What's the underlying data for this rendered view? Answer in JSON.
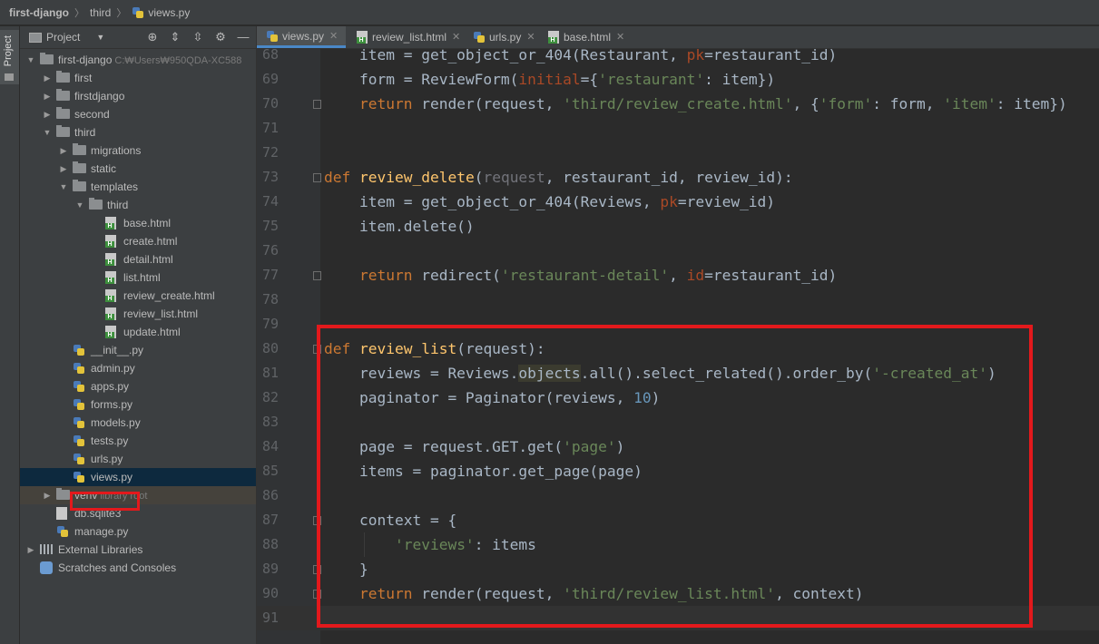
{
  "breadcrumb": {
    "project": "first-django",
    "folder": "third",
    "file": "views.py"
  },
  "toolwindow": {
    "label": "Project"
  },
  "project_panel": {
    "title": "Project",
    "tree": [
      {
        "name": "first-django",
        "indent": 0,
        "type": "folder",
        "expanded": true,
        "extra": "C:₩Users₩950QDA-XC588"
      },
      {
        "name": "first",
        "indent": 1,
        "type": "folder",
        "expanded": false,
        "extra": ""
      },
      {
        "name": "firstdjango",
        "indent": 1,
        "type": "folder",
        "expanded": false,
        "extra": ""
      },
      {
        "name": "second",
        "indent": 1,
        "type": "folder",
        "expanded": false,
        "extra": ""
      },
      {
        "name": "third",
        "indent": 1,
        "type": "folder",
        "expanded": true,
        "extra": ""
      },
      {
        "name": "migrations",
        "indent": 2,
        "type": "folder",
        "expanded": false,
        "extra": ""
      },
      {
        "name": "static",
        "indent": 2,
        "type": "folder",
        "expanded": false,
        "extra": ""
      },
      {
        "name": "templates",
        "indent": 2,
        "type": "folder",
        "expanded": true,
        "extra": ""
      },
      {
        "name": "third",
        "indent": 3,
        "type": "folder",
        "expanded": true,
        "extra": ""
      },
      {
        "name": "base.html",
        "indent": 4,
        "type": "html",
        "extra": ""
      },
      {
        "name": "create.html",
        "indent": 4,
        "type": "html",
        "extra": ""
      },
      {
        "name": "detail.html",
        "indent": 4,
        "type": "html",
        "extra": ""
      },
      {
        "name": "list.html",
        "indent": 4,
        "type": "html",
        "extra": ""
      },
      {
        "name": "review_create.html",
        "indent": 4,
        "type": "html",
        "extra": ""
      },
      {
        "name": "review_list.html",
        "indent": 4,
        "type": "html",
        "extra": ""
      },
      {
        "name": "update.html",
        "indent": 4,
        "type": "html",
        "extra": ""
      },
      {
        "name": "__init__.py",
        "indent": 2,
        "type": "py",
        "extra": ""
      },
      {
        "name": "admin.py",
        "indent": 2,
        "type": "py",
        "extra": ""
      },
      {
        "name": "apps.py",
        "indent": 2,
        "type": "py",
        "extra": ""
      },
      {
        "name": "forms.py",
        "indent": 2,
        "type": "py",
        "extra": ""
      },
      {
        "name": "models.py",
        "indent": 2,
        "type": "py",
        "extra": ""
      },
      {
        "name": "tests.py",
        "indent": 2,
        "type": "py",
        "extra": ""
      },
      {
        "name": "urls.py",
        "indent": 2,
        "type": "py",
        "extra": ""
      },
      {
        "name": "views.py",
        "indent": 2,
        "type": "py",
        "extra": "",
        "selected": true
      },
      {
        "name": "venv",
        "indent": 1,
        "type": "folder",
        "expanded": false,
        "extra": "library root",
        "venv": true
      },
      {
        "name": "db.sqlite3",
        "indent": 1,
        "type": "db",
        "extra": ""
      },
      {
        "name": "manage.py",
        "indent": 1,
        "type": "py",
        "extra": ""
      },
      {
        "name": "External Libraries",
        "indent": 0,
        "type": "lib",
        "expanded": false,
        "extra": ""
      },
      {
        "name": "Scratches and Consoles",
        "indent": 0,
        "type": "scratch",
        "extra": ""
      }
    ]
  },
  "tabs": [
    {
      "label": "views.py",
      "icon": "py",
      "active": true
    },
    {
      "label": "review_list.html",
      "icon": "html",
      "active": false
    },
    {
      "label": "urls.py",
      "icon": "py",
      "active": false
    },
    {
      "label": "base.html",
      "icon": "html",
      "active": false
    }
  ],
  "editor": {
    "current_line": 91,
    "lines": [
      {
        "n": 68,
        "segs": [
          [
            "    item = get_object_or_404(Restaurant, ",
            ""
          ],
          [
            "pk",
            "param"
          ],
          [
            "=restaurant_id)",
            ""
          ]
        ]
      },
      {
        "n": 69,
        "segs": [
          [
            "    form = ReviewForm(",
            ""
          ],
          [
            "initial",
            "param"
          ],
          [
            "={",
            ""
          ],
          [
            "'restaurant'",
            "str"
          ],
          [
            ": item})",
            ""
          ]
        ]
      },
      {
        "n": 70,
        "segs": [
          [
            "    ",
            ""
          ],
          [
            "return",
            "kw"
          ],
          [
            " render(request, ",
            ""
          ],
          [
            "'third/review_create.html'",
            "str"
          ],
          [
            ", {",
            ""
          ],
          [
            "'form'",
            "str"
          ],
          [
            ": form, ",
            ""
          ],
          [
            "'item'",
            "str"
          ],
          [
            ": item})",
            ""
          ]
        ]
      },
      {
        "n": 71,
        "segs": []
      },
      {
        "n": 72,
        "segs": []
      },
      {
        "n": 73,
        "segs": [
          [
            "def",
            "kw"
          ],
          [
            " ",
            ""
          ],
          [
            "review_delete",
            "fn"
          ],
          [
            "(",
            ""
          ],
          [
            "request",
            "gray"
          ],
          [
            ", restaurant_id, review_id):",
            ""
          ]
        ]
      },
      {
        "n": 74,
        "segs": [
          [
            "    item = get_object_or_404(Reviews, ",
            ""
          ],
          [
            "pk",
            "param"
          ],
          [
            "=review_id)",
            ""
          ]
        ]
      },
      {
        "n": 75,
        "segs": [
          [
            "    item.delete()",
            ""
          ]
        ]
      },
      {
        "n": 76,
        "segs": []
      },
      {
        "n": 77,
        "segs": [
          [
            "    ",
            ""
          ],
          [
            "return",
            "kw"
          ],
          [
            " redirect(",
            ""
          ],
          [
            "'restaurant-detail'",
            "str"
          ],
          [
            ", ",
            ""
          ],
          [
            "id",
            "param"
          ],
          [
            "=restaurant_id)",
            ""
          ]
        ]
      },
      {
        "n": 78,
        "segs": []
      },
      {
        "n": 79,
        "segs": []
      },
      {
        "n": 80,
        "segs": [
          [
            "def",
            "kw"
          ],
          [
            " ",
            ""
          ],
          [
            "review_list",
            "fn"
          ],
          [
            "(request):",
            ""
          ]
        ]
      },
      {
        "n": 81,
        "segs": [
          [
            "    reviews = Reviews.",
            ""
          ],
          [
            "objects",
            "obj"
          ],
          [
            ".all().select_related().order_by(",
            ""
          ],
          [
            "'-created_at'",
            "str"
          ],
          [
            ")",
            ""
          ]
        ]
      },
      {
        "n": 82,
        "segs": [
          [
            "    paginator = Paginator(reviews, ",
            ""
          ],
          [
            "10",
            "num"
          ],
          [
            ")",
            ""
          ]
        ]
      },
      {
        "n": 83,
        "segs": []
      },
      {
        "n": 84,
        "segs": [
          [
            "    page = request.GET.get(",
            ""
          ],
          [
            "'page'",
            "str"
          ],
          [
            ")",
            ""
          ]
        ]
      },
      {
        "n": 85,
        "segs": [
          [
            "    items = paginator.get_page(page)",
            ""
          ]
        ]
      },
      {
        "n": 86,
        "segs": []
      },
      {
        "n": 87,
        "segs": [
          [
            "    context = {",
            ""
          ]
        ]
      },
      {
        "n": 88,
        "segs": [
          [
            "        ",
            ""
          ],
          [
            "'reviews'",
            "str"
          ],
          [
            ": items",
            ""
          ]
        ]
      },
      {
        "n": 89,
        "segs": [
          [
            "    }",
            ""
          ]
        ]
      },
      {
        "n": 90,
        "segs": [
          [
            "    ",
            ""
          ],
          [
            "return",
            "kw"
          ],
          [
            " render(request, ",
            ""
          ],
          [
            "'third/review_list.html'",
            "str"
          ],
          [
            ", context)",
            ""
          ]
        ]
      },
      {
        "n": 91,
        "segs": []
      }
    ]
  },
  "colors": {
    "accent": "#4a88c7",
    "highlight": "#e3191c",
    "keyword": "#cc7832",
    "function": "#ffc66d",
    "string": "#6a8759",
    "number": "#6897bb"
  }
}
